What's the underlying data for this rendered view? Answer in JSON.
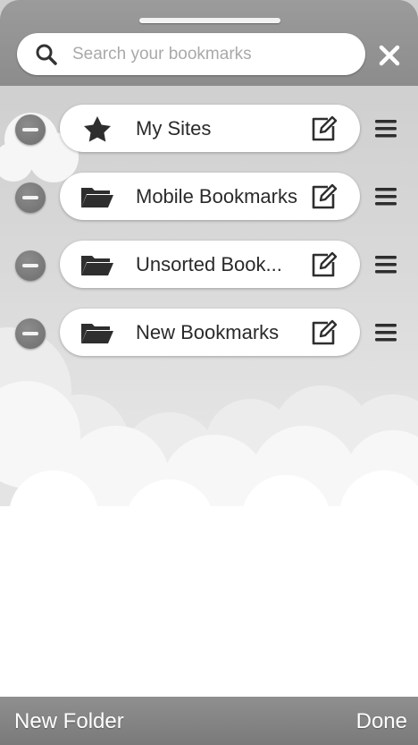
{
  "search": {
    "placeholder": "Search your bookmarks",
    "value": ""
  },
  "close": {
    "icon": "close-icon"
  },
  "folders": [
    {
      "label": "My Sites",
      "icon": "star-icon"
    },
    {
      "label": "Mobile Bookmarks",
      "icon": "folder-icon"
    },
    {
      "label": "Unsorted Book...",
      "icon": "folder-icon"
    },
    {
      "label": "New Bookmarks",
      "icon": "folder-icon"
    }
  ],
  "footer": {
    "new_folder_label": "New Folder",
    "done_label": "Done"
  }
}
